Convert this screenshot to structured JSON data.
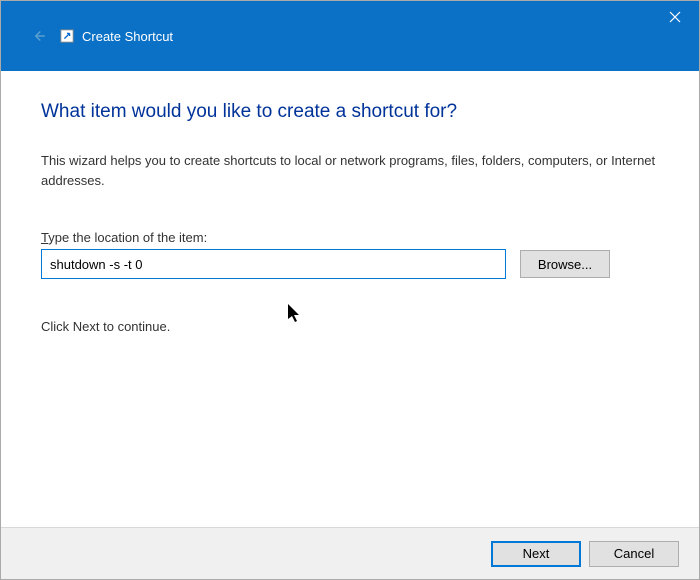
{
  "titlebar": {
    "title": "Create Shortcut"
  },
  "content": {
    "heading": "What item would you like to create a shortcut for?",
    "description": "This wizard helps you to create shortcuts to local or network programs, files, folders, computers, or Internet addresses.",
    "field_label_prefix": "T",
    "field_label_rest": "ype the location of the item:",
    "location_value": "shutdown -s -t 0",
    "browse_label": "Browse...",
    "continue_text": "Click Next to continue."
  },
  "footer": {
    "next_label": "Next",
    "cancel_label": "Cancel"
  }
}
